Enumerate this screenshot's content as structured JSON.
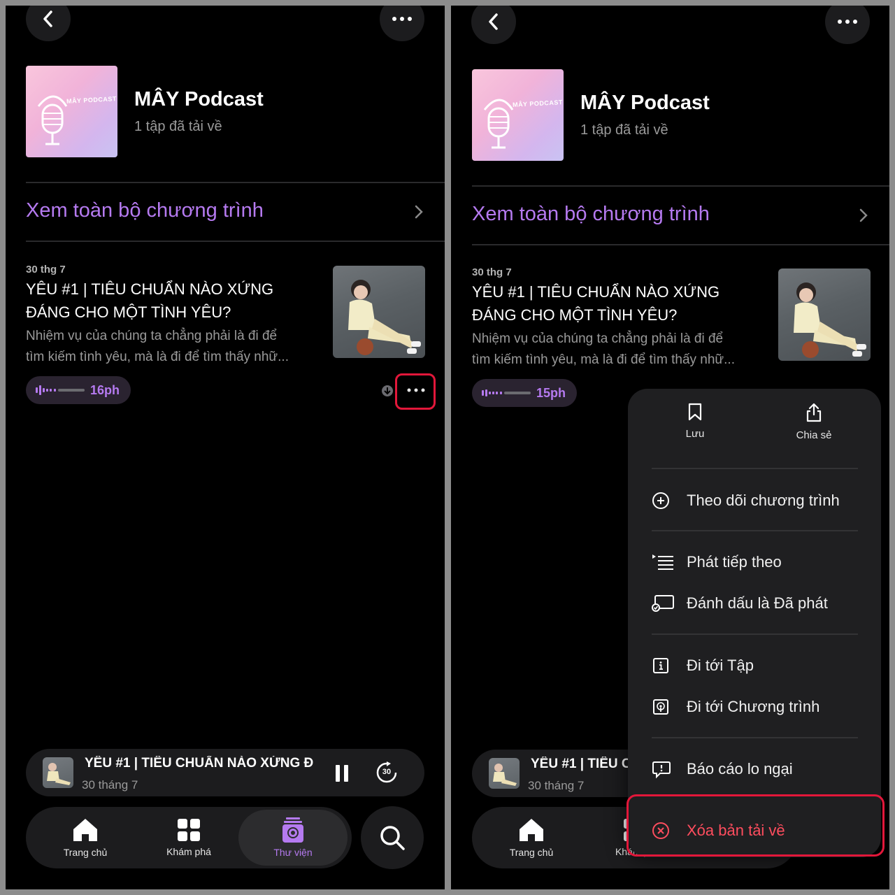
{
  "podcast": {
    "title": "MÂY Podcast",
    "cover_text": "MÂY PODCAST",
    "downloaded_count": "1 tập đã tải về"
  },
  "see_all": {
    "label": "Xem toàn bộ chương trình"
  },
  "episode": {
    "date": "30 thg 7",
    "title": "YÊU #1 | TIÊU CHUẨN NÀO XỨNG ĐÁNG CHO MỘT TÌNH YÊU?",
    "description_line1": "Nhiệm vụ của chúng ta chẳng phải là đi để",
    "description_line2": "tìm kiếm tình yêu, mà là đi để tìm thấy nhữ...",
    "duration_left": "16ph",
    "duration_right": "15ph"
  },
  "mini_player": {
    "title_left": "YÊU #1 | TIÊU CHUẨN NÀO XỨNG Đ",
    "title_right": "YÊU #1 | TIÊU C",
    "date": "30 tháng 7",
    "skip_label": "30"
  },
  "tabs": [
    {
      "label": "Trang chủ",
      "icon": "home-icon"
    },
    {
      "label": "Khám phá",
      "icon": "grid-icon"
    },
    {
      "label": "Thư viện",
      "icon": "library-icon"
    }
  ],
  "tab_partial_right": "Khám ph",
  "menu": {
    "save": "Lưu",
    "share": "Chia sẻ",
    "follow": "Theo dõi chương trình",
    "play_next": "Phát tiếp theo",
    "mark_played": "Đánh dấu là Đã phát",
    "go_episode": "Đi tới Tập",
    "go_show": "Đi tới Chương trình",
    "report": "Báo cáo lo ngại",
    "remove_download": "Xóa bản tải về"
  },
  "colors": {
    "accent": "#b57af0",
    "highlight_box": "#e2173a",
    "danger": "#ff4d5e",
    "background": "#000000"
  }
}
